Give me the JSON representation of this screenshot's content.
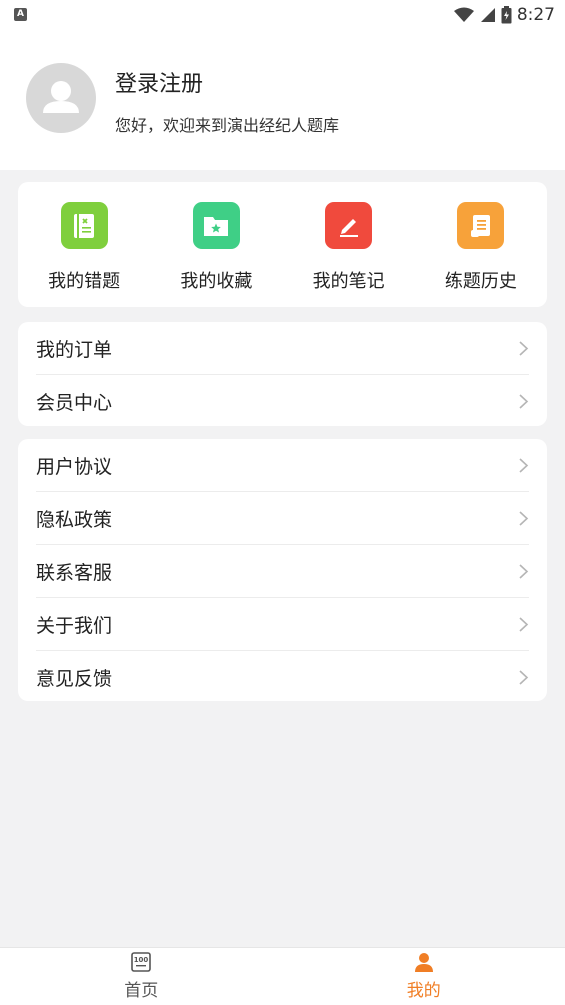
{
  "status_bar": {
    "time": "8:27",
    "left_icon": "A",
    "icons": [
      "wifi-icon",
      "signal-icon",
      "battery-icon"
    ]
  },
  "profile": {
    "login_label": "登录注册",
    "welcome_text": "您好，欢迎来到演出经纪人题库",
    "avatar_icon": "user-avatar-icon"
  },
  "quick_actions": [
    {
      "label": "我的错题",
      "icon": "wrong-book-icon",
      "color": "#7fcf3d"
    },
    {
      "label": "我的收藏",
      "icon": "star-folder-icon",
      "color": "#3fcf86"
    },
    {
      "label": "我的笔记",
      "icon": "pencil-note-icon",
      "color": "#f04a3d"
    },
    {
      "label": "练题历史",
      "icon": "history-scroll-icon",
      "color": "#f7a23a"
    }
  ],
  "menu_group_1": [
    {
      "label": "我的订单"
    },
    {
      "label": "会员中心"
    }
  ],
  "menu_group_2": [
    {
      "label": "用户协议"
    },
    {
      "label": "隐私政策"
    },
    {
      "label": "联系客服"
    },
    {
      "label": "关于我们"
    },
    {
      "label": "意见反馈"
    }
  ],
  "tabbar": {
    "tabs": [
      {
        "label": "首页",
        "icon": "home-100-icon",
        "active": false
      },
      {
        "label": "我的",
        "icon": "person-icon",
        "active": true
      }
    ],
    "active_color": "#f07e25",
    "inactive_color": "#555555"
  }
}
